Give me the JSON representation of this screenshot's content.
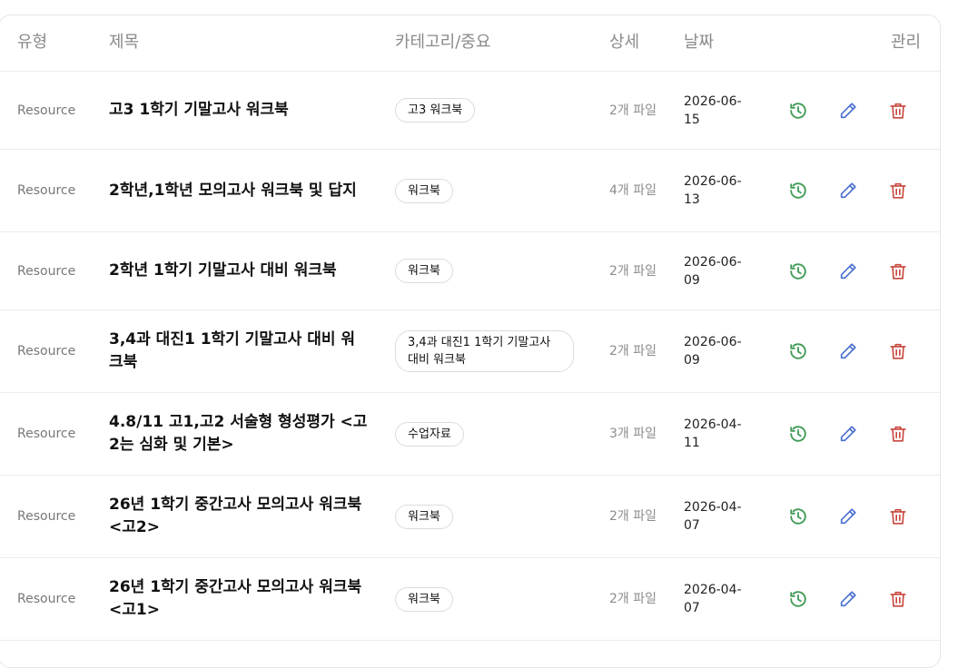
{
  "columns": {
    "type": "유형",
    "title": "제목",
    "category": "카테고리/중요",
    "detail": "상세",
    "date": "날짜",
    "manage": "관리"
  },
  "colors": {
    "history": "#3f9a55",
    "edit": "#4a6fd1",
    "delete": "#c8483e"
  },
  "icons": {
    "history": "history-icon",
    "edit": "pencil-icon",
    "delete": "trash-icon"
  },
  "rows": [
    {
      "type": "Resource",
      "title": "고3 1학기 기말고사 워크북",
      "category": "고3 워크북",
      "files": "2개 파일",
      "date": "2026-06-15"
    },
    {
      "type": "Resource",
      "title": "2학년,1학년 모의고사 워크북 및 답지",
      "category": "워크북",
      "files": "4개 파일",
      "date": "2026-06-13"
    },
    {
      "type": "Resource",
      "title": "2학년 1학기 기말고사 대비 워크북",
      "category": "워크북",
      "files": "2개 파일",
      "date": "2026-06-09"
    },
    {
      "type": "Resource",
      "title": "3,4과 대진1 1학기 기말고사 대비 워크북",
      "category": "3,4과 대진1 1학기 기말고사 대비 워크북",
      "files": "2개 파일",
      "date": "2026-06-09"
    },
    {
      "type": "Resource",
      "title": "4.8/11 고1,고2 서술형 형성평가 <고2는 심화 및 기본>",
      "category": "수업자료",
      "files": "3개 파일",
      "date": "2026-04-11"
    },
    {
      "type": "Resource",
      "title": "26년 1학기 중간고사 모의고사 워크북 <고2>",
      "category": "워크북",
      "files": "2개 파일",
      "date": "2026-04-07"
    },
    {
      "type": "Resource",
      "title": "26년 1학기 중간고사 모의고사 워크북 <고1>",
      "category": "워크북",
      "files": "2개 파일",
      "date": "2026-04-07"
    }
  ]
}
